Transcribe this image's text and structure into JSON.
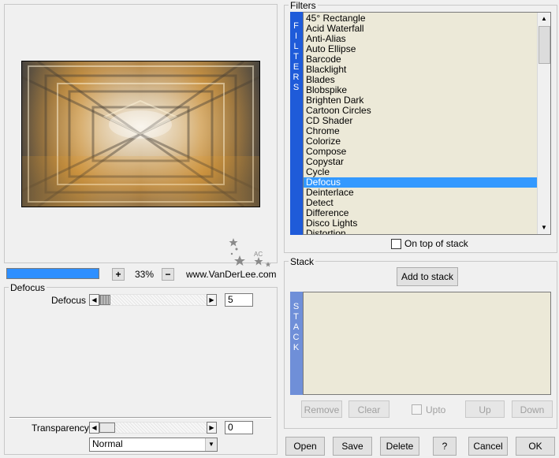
{
  "preview": {
    "zoom_plus": "+",
    "zoom_value": "33%",
    "zoom_minus": "−",
    "website": "www.VanDerLee.com",
    "logo_text": "AC"
  },
  "defocus_group": {
    "title": "Defocus",
    "param_label": "Defocus",
    "param_value": "5",
    "param_fraction": 0.0
  },
  "transparency": {
    "label": "Transparency",
    "value": "0",
    "fraction": 0.0,
    "blend_mode": "Normal"
  },
  "filters_group": {
    "title": "Filters",
    "sidebar": [
      "F",
      "I",
      "L",
      "T",
      "E",
      "R",
      "S"
    ],
    "items": [
      "45° Rectangle",
      "Acid Waterfall",
      "Anti-Alias",
      "Auto Ellipse",
      "Barcode",
      "Blacklight",
      "Blades",
      "Blobspike",
      "Brighten Dark",
      "Cartoon Circles",
      "CD Shader",
      "Chrome",
      "Colorize",
      "Compose",
      "Copystar",
      "Cycle",
      "Defocus",
      "Deinterlace",
      "Detect",
      "Difference",
      "Disco Lights",
      "Distortion"
    ],
    "selected": "Defocus",
    "on_top_label": "On top of stack"
  },
  "stack_group": {
    "title": "Stack",
    "sidebar": [
      "S",
      "T",
      "A",
      "C",
      "K"
    ],
    "add_label": "Add to stack",
    "remove_label": "Remove",
    "clear_label": "Clear",
    "upto_label": "Upto",
    "up_label": "Up",
    "down_label": "Down"
  },
  "buttons": {
    "open": "Open",
    "save": "Save",
    "delete": "Delete",
    "help": "?",
    "cancel": "Cancel",
    "ok": "OK"
  },
  "icons": {
    "scroll_left": "◀",
    "scroll_right": "▶",
    "scroll_up": "▲",
    "scroll_down": "▼",
    "dropdown": "▼"
  }
}
